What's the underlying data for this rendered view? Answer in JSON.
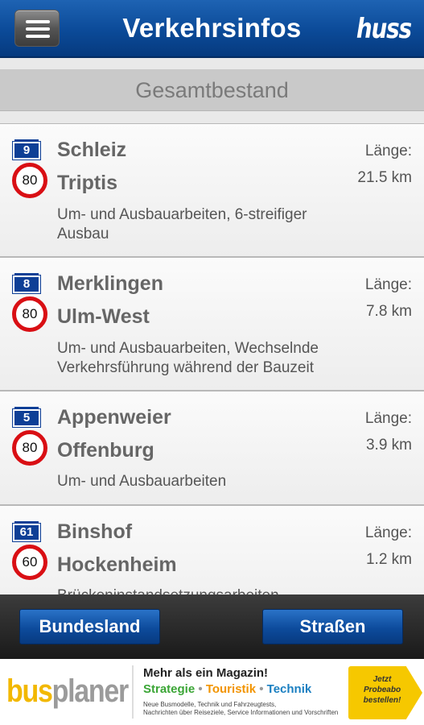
{
  "header": {
    "title": "Verkehrsinfos",
    "logo": "huss",
    "menu_icon": "hamburger-menu-icon"
  },
  "subheader": {
    "title": "Gesamtbestand"
  },
  "items": [
    {
      "highway": "9",
      "speed": "80",
      "from": "Schleiz",
      "to": "Triptis",
      "description": "Um- und Ausbauarbeiten, 6-streifiger Ausbau",
      "length_label": "Länge:",
      "length": "21.5 km"
    },
    {
      "highway": "8",
      "speed": "80",
      "from": "Merklingen",
      "to": "Ulm-West",
      "description": "Um- und Ausbauarbeiten, Wechselnde Verkehrsführung während der Bauzeit",
      "length_label": "Länge:",
      "length": "7.8 km"
    },
    {
      "highway": "5",
      "speed": "80",
      "from": "Appenweier",
      "to": "Offenburg",
      "description": "Um- und Ausbauarbeiten",
      "length_label": "Länge:",
      "length": "3.9 km"
    },
    {
      "highway": "61",
      "speed": "60",
      "from": "Binshof",
      "to": "Hockenheim",
      "description": "Brückeninstandsetzungsarbeiten",
      "length_label": "Länge:",
      "length": "1.2 km"
    }
  ],
  "bottom_bar": {
    "left_button": "Bundesland",
    "right_button": "Straßen"
  },
  "ad": {
    "logo_part1": "bus",
    "logo_part2": "planer",
    "headline": "Mehr als ein Magazin!",
    "tag1": "Strategie",
    "tag2": "Touristik",
    "tag3": "Technik",
    "separator": "•",
    "small_line1": "Neue Busmodelle, Technik und Fahrzeugtests,",
    "small_line2": "Nachrichten über Reiseziele, Service Informationen und Vorschriften",
    "cta": "Jetzt Probeabo bestellen!",
    "brand_color": "#f2b800"
  }
}
